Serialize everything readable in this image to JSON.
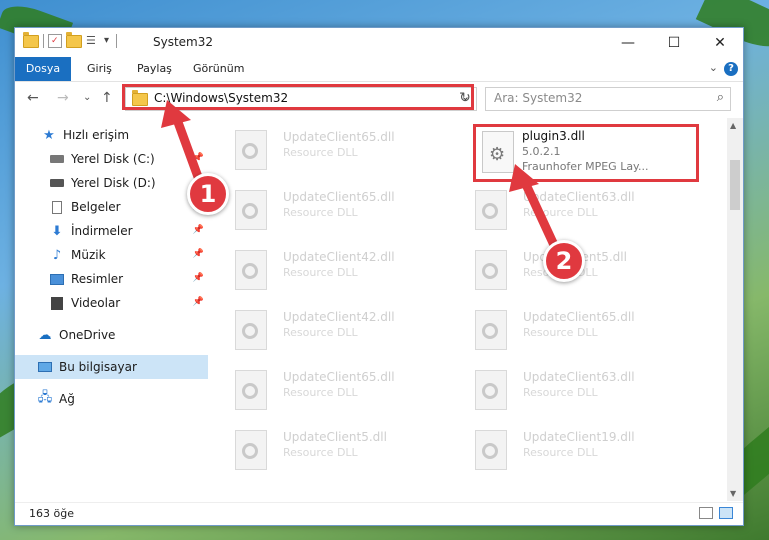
{
  "titlebar": {
    "path_title": "System32",
    "minimize": "—",
    "maximize": "☐",
    "close": "✕"
  },
  "ribbon": {
    "tabs": [
      "Dosya",
      "Giriş",
      "Paylaş",
      "Görünüm"
    ],
    "collapse_chevron": "⌄",
    "help": "?"
  },
  "navbar": {
    "back": "←",
    "forward": "→",
    "recent": "⌄",
    "up": "↑",
    "address": "C:\\Windows\\System32",
    "address_dropdown": "⌄",
    "refresh": "↻",
    "search_placeholder": "Ara: System32",
    "search_icon": "⌕"
  },
  "sidebar": {
    "items": [
      {
        "label": "Hızlı erişim",
        "icon": "star-icon"
      },
      {
        "label": "Yerel Disk (C:)",
        "icon": "drive-icon",
        "pinned": true
      },
      {
        "label": "Yerel Disk (D:)",
        "icon": "drive-icon",
        "pinned": true
      },
      {
        "label": "Belgeler",
        "icon": "document-icon",
        "pinned": true
      },
      {
        "label": "İndirmeler",
        "icon": "download-icon",
        "pinned": true
      },
      {
        "label": "Müzik",
        "icon": "music-icon",
        "pinned": true
      },
      {
        "label": "Resimler",
        "icon": "pictures-icon",
        "pinned": true
      },
      {
        "label": "Videolar",
        "icon": "video-icon",
        "pinned": true
      },
      {
        "label": "OneDrive",
        "icon": "cloud-icon"
      },
      {
        "label": "Bu bilgisayar",
        "icon": "computer-icon",
        "selected": true
      },
      {
        "label": "Ağ",
        "icon": "network-icon"
      }
    ]
  },
  "files": {
    "highlighted": {
      "name": "plugin3.dll",
      "version": "5.0.2.1",
      "description": "Fraunhofer MPEG Lay..."
    },
    "left_column": [
      {
        "name": "UpdateClient65.dll",
        "sub": "Resource DLL"
      },
      {
        "name": "UpdateClient65.dll",
        "sub": "Resource DLL"
      },
      {
        "name": "UpdateClient42.dll",
        "sub": "Resource DLL"
      },
      {
        "name": "UpdateClient42.dll",
        "sub": "Resource DLL"
      },
      {
        "name": "UpdateClient65.dll",
        "sub": "Resource DLL"
      },
      {
        "name": "UpdateClient5.dll",
        "sub": "Resource DLL"
      }
    ],
    "right_column": [
      {
        "name": "UpdateClient63.dll",
        "sub": "Resource DLL"
      },
      {
        "name": "UpdateClient5.dll",
        "sub": "Resource DLL"
      },
      {
        "name": "UpdateClient65.dll",
        "sub": "Resource DLL"
      },
      {
        "name": "UpdateClient63.dll",
        "sub": "Resource DLL"
      },
      {
        "name": "UpdateClient19.dll",
        "sub": "Resource DLL"
      }
    ]
  },
  "status": {
    "count": "163 öğe"
  },
  "annotations": {
    "step1": "1",
    "step2": "2",
    "color": "#e0393f"
  }
}
